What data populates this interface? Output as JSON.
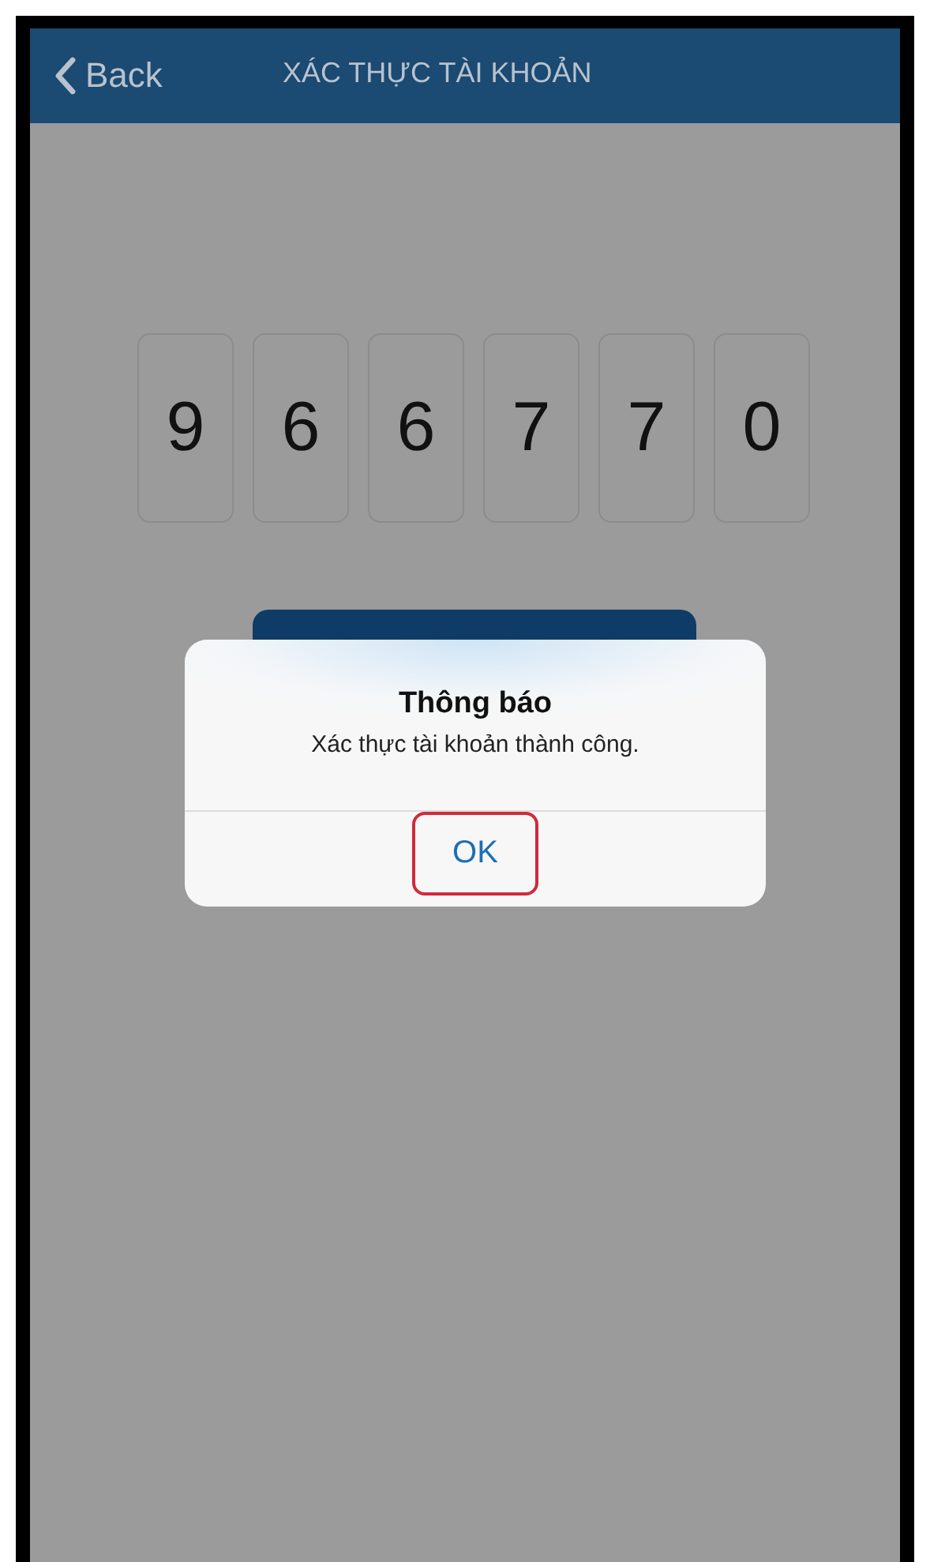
{
  "nav_bar": {
    "back_label": "Back",
    "title": "XÁC THỰC TÀI KHOẢN"
  },
  "code_digits": [
    "9",
    "6",
    "6",
    "7",
    "7",
    "0"
  ],
  "alert": {
    "title": "Thông báo",
    "message": "Xác thực tài khoản thành công.",
    "buttons": [
      {
        "label": "OK",
        "highlighted": true
      }
    ]
  }
}
